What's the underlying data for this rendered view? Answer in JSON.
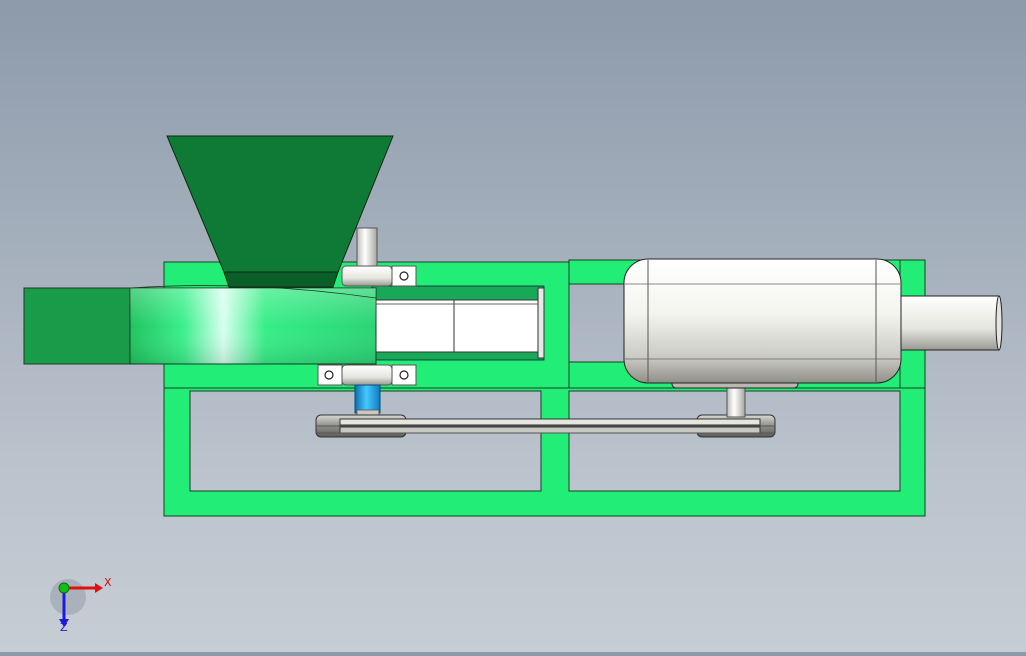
{
  "viewport": {
    "background_top": "#8d9aaa",
    "background_bottom": "#c7cdd4"
  },
  "model": {
    "frame_color": "#22ee77",
    "hopper_color": "#0f7a35",
    "barrel_color": "#2ee87a",
    "motor_color": "#f2f2ee",
    "coupling_color": "#1aa6e0"
  },
  "triad": {
    "x_label": "X",
    "z_label": "Z",
    "x_color": "#e01010",
    "y_color": "#10c010",
    "z_color": "#1a1ae0"
  }
}
